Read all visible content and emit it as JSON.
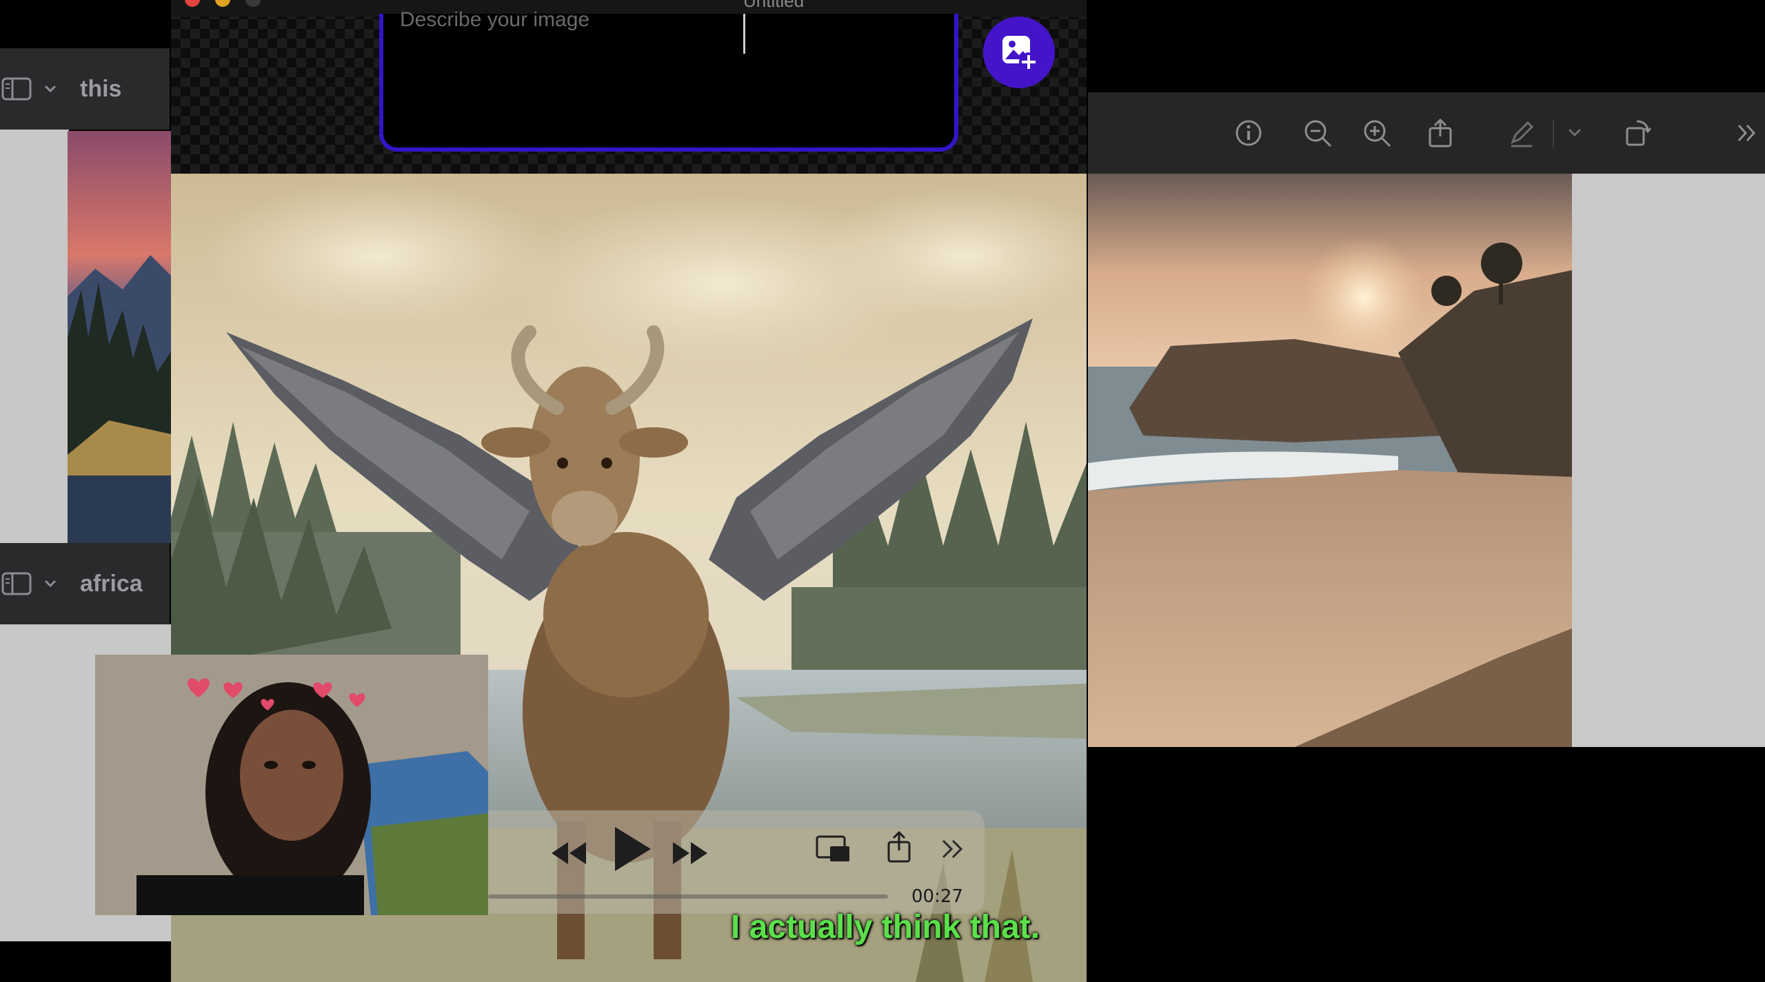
{
  "generator": {
    "prompt_placeholder": "Describe your image",
    "tab_label": "Untitled",
    "add_image_label": "Add image"
  },
  "left_windows": [
    {
      "title": "this"
    },
    {
      "title": "africa"
    }
  ],
  "right_viewer": {
    "toolbar_icons": [
      "info-icon",
      "zoom-out-icon",
      "zoom-in-icon",
      "share-icon",
      "markup-pen-icon",
      "chevron-down-icon",
      "rotate-icon",
      "more-chevrons-icon"
    ]
  },
  "video_player": {
    "time": "00:27",
    "progress": 0.0,
    "caption": "I actually think that."
  },
  "colors": {
    "accent_purple": "#4415c8",
    "caption_green": "#5be04a"
  }
}
